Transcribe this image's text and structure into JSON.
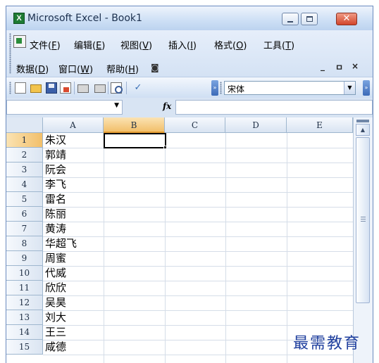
{
  "window": {
    "title": "Microsoft Excel - Book1",
    "app_icon": "X"
  },
  "menus": {
    "file": {
      "label": "文件(",
      "key": "F",
      "tail": ")"
    },
    "edit": {
      "label": "编辑(",
      "key": "E",
      "tail": ")"
    },
    "view": {
      "label": "视图(",
      "key": "V",
      "tail": ")"
    },
    "insert": {
      "label": "插入(",
      "key": "I",
      "tail": ")"
    },
    "format": {
      "label": "格式(",
      "key": "O",
      "tail": ")"
    },
    "tools": {
      "label": "工具(",
      "key": "T",
      "tail": ")"
    },
    "data": {
      "label": "数据(",
      "key": "D",
      "tail": ")"
    },
    "window": {
      "label": "窗口(",
      "key": "W",
      "tail": ")"
    },
    "help": {
      "label": "帮助(",
      "key": "H",
      "tail": ")"
    },
    "doc_controls": {
      "minimize": "_",
      "restore": "ㅁ",
      "close": "×"
    }
  },
  "toolbar": {
    "font_name": "宋体",
    "icons": [
      "new-icon",
      "open-icon",
      "save-icon",
      "permission-icon",
      "print-icon",
      "print-preview-icon",
      "spelling-icon"
    ]
  },
  "formula_bar": {
    "name_box": "",
    "fx_label": "fx",
    "formula": ""
  },
  "sheet": {
    "columns": [
      "A",
      "B",
      "C",
      "D",
      "E"
    ],
    "selected_column": "B",
    "selected_row": 1,
    "active_cell": "B1",
    "rows": [
      {
        "num": "1",
        "a": "朱汉"
      },
      {
        "num": "2",
        "a": "郭靖"
      },
      {
        "num": "3",
        "a": "阮会"
      },
      {
        "num": "4",
        "a": "李飞"
      },
      {
        "num": "5",
        "a": "雷名"
      },
      {
        "num": "6",
        "a": "陈丽"
      },
      {
        "num": "7",
        "a": "黄涛"
      },
      {
        "num": "8",
        "a": "华超飞"
      },
      {
        "num": "9",
        "a": "周蜜"
      },
      {
        "num": "10",
        "a": "代威"
      },
      {
        "num": "11",
        "a": "欣欣"
      },
      {
        "num": "12",
        "a": "吴昊"
      },
      {
        "num": "13",
        "a": "刘大"
      },
      {
        "num": "14",
        "a": "王三"
      },
      {
        "num": "15",
        "a": "咸德"
      }
    ]
  },
  "watermark": "最需教育"
}
